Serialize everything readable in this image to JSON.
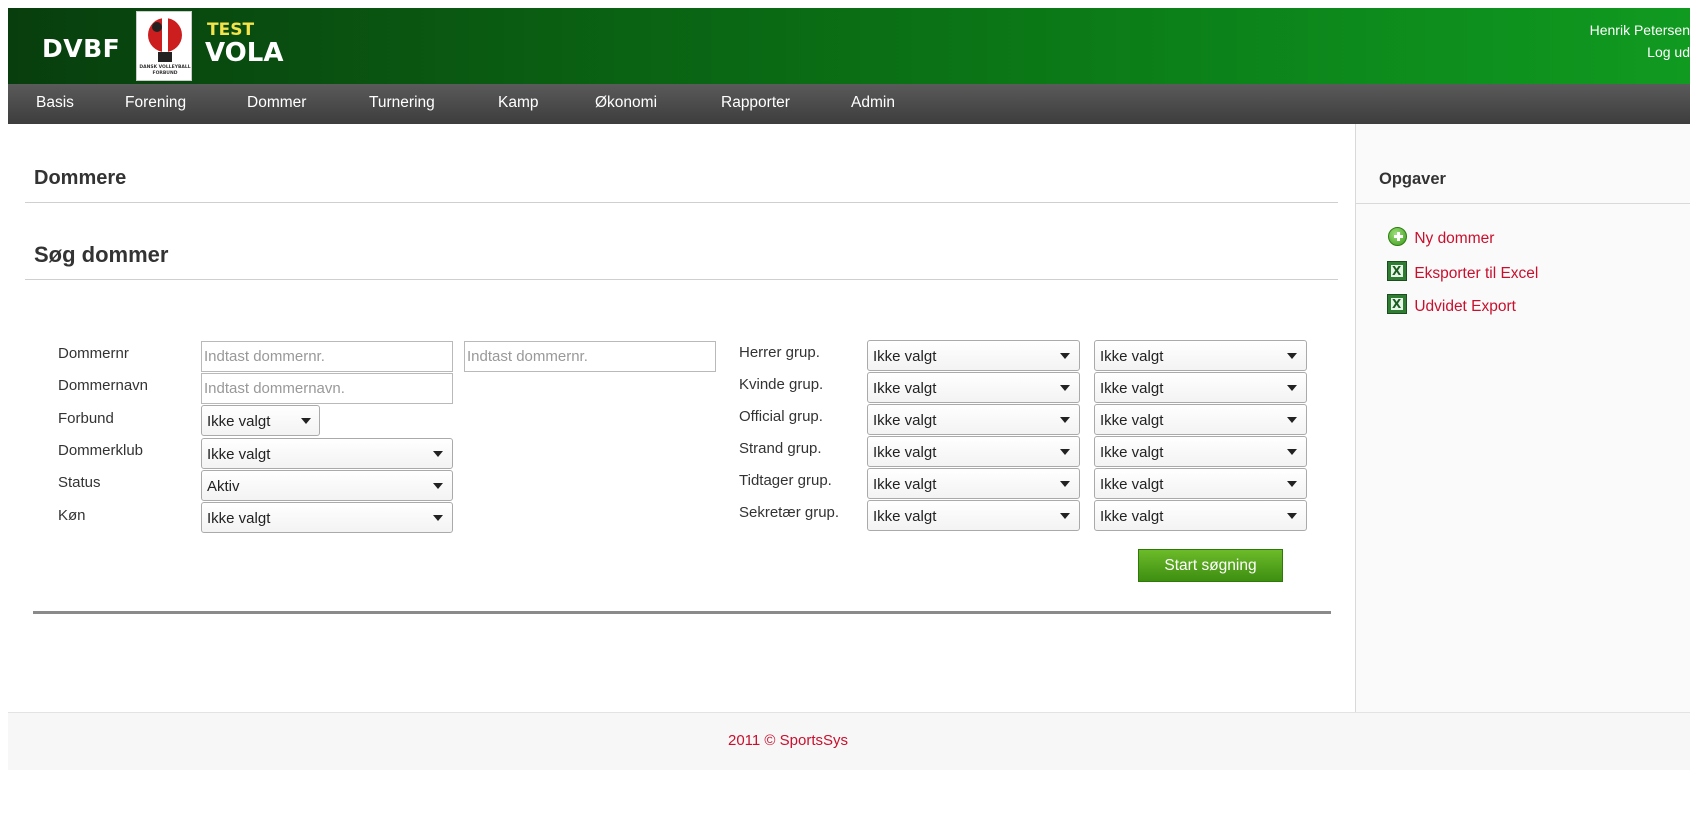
{
  "header": {
    "org": "DVBF",
    "badge": "TEST",
    "app": "VOLA",
    "emblem_text": "DANSK VOLLEYBALL FORBUND",
    "user": "Henrik Petersen",
    "logout": "Log ud"
  },
  "nav": [
    "Basis",
    "Forening",
    "Dommer",
    "Turnering",
    "Kamp",
    "Økonomi",
    "Rapporter",
    "Admin"
  ],
  "page": {
    "title": "Dommere",
    "search_title": "Søg dommer"
  },
  "form_left": {
    "dommernr_label": "Dommernr",
    "dommernr_from_placeholder": "Indtast dommernr.",
    "dommernr_to_placeholder": "Indtast dommernr.",
    "dommernavn_label": "Dommernavn",
    "dommernavn_placeholder": "Indtast dommernavn.",
    "forbund_label": "Forbund",
    "forbund_value": "Ikke valgt",
    "dommerklub_label": "Dommerklub",
    "dommerklub_value": "Ikke valgt",
    "status_label": "Status",
    "status_value": "Aktiv",
    "kon_label": "Køn",
    "kon_value": "Ikke valgt"
  },
  "form_right": [
    {
      "label": "Herrer grup.",
      "from": "Ikke valgt",
      "to": "Ikke valgt"
    },
    {
      "label": "Kvinde grup.",
      "from": "Ikke valgt",
      "to": "Ikke valgt"
    },
    {
      "label": "Official grup.",
      "from": "Ikke valgt",
      "to": "Ikke valgt"
    },
    {
      "label": "Strand grup.",
      "from": "Ikke valgt",
      "to": "Ikke valgt"
    },
    {
      "label": "Tidtager grup.",
      "from": "Ikke valgt",
      "to": "Ikke valgt"
    },
    {
      "label": "Sekretær grup.",
      "from": "Ikke valgt",
      "to": "Ikke valgt"
    }
  ],
  "search_button": "Start søgning",
  "sidebar": {
    "title": "Opgaver",
    "links": [
      {
        "label": "Ny dommer",
        "icon": "add-icon"
      },
      {
        "label": "Eksporter til Excel",
        "icon": "excel-icon"
      },
      {
        "label": "Udvidet Export",
        "icon": "excel-icon"
      }
    ]
  },
  "footer": "2011 © SportsSys",
  "colors": {
    "header_green": "#0b7716",
    "nav_gray": "#4a4a4a",
    "button_green": "#4fa31c",
    "link_red": "#c8102e"
  }
}
